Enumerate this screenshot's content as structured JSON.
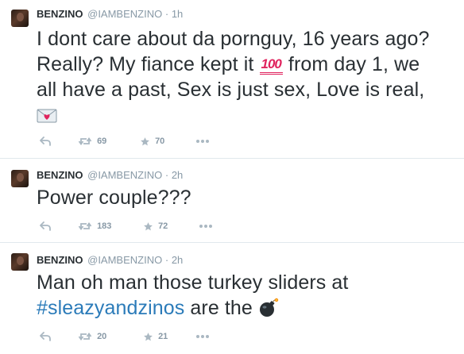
{
  "colors": {
    "text": "#292f33",
    "muted": "#8899a6",
    "link": "#2b7bb9",
    "divider": "#e1e8ed"
  },
  "tweets": [
    {
      "name": "BENZINO",
      "handle": "@IAMBENZINO",
      "separator": "·",
      "time": "1h",
      "text_line_1": "I dont care about da pornguy, 16 years ago?",
      "text_line_2a": "Really? My fiance kept it",
      "emoji_100": "100",
      "text_line_2b": "from day 1, we",
      "text_line_3": "all have a past, Sex is just sex, Love is real,",
      "emoji_end": "love-letter-emoji",
      "retweets": "69",
      "favorites": "70"
    },
    {
      "name": "BENZINO",
      "handle": "@IAMBENZINO",
      "separator": "·",
      "time": "2h",
      "text": "Power couple???",
      "retweets": "183",
      "favorites": "72"
    },
    {
      "name": "BENZINO",
      "handle": "@IAMBENZINO",
      "separator": "·",
      "time": "2h",
      "text_line_1": "Man oh man those turkey sliders at",
      "hashtag": "#sleazyandzinos",
      "text_line_2": "are the",
      "emoji_end": "bomb-emoji",
      "retweets": "20",
      "favorites": "21"
    }
  ]
}
